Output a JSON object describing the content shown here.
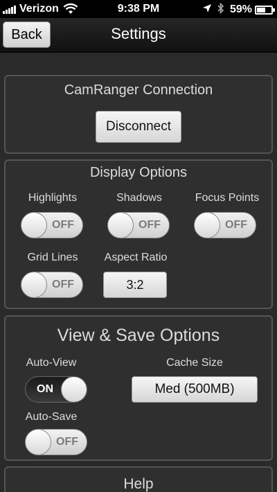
{
  "status_bar": {
    "carrier": "Verizon",
    "time": "9:38 PM",
    "battery": "59%",
    "battery_level_percent": 59,
    "icons": [
      "signal-icon",
      "wifi-icon",
      "location-icon",
      "bluetooth-icon",
      "battery-icon"
    ]
  },
  "nav": {
    "back_label": "Back",
    "title": "Settings"
  },
  "connection": {
    "title": "CamRanger Connection",
    "disconnect_label": "Disconnect"
  },
  "display": {
    "title": "Display Options",
    "highlights": {
      "label": "Highlights",
      "state": "OFF"
    },
    "shadows": {
      "label": "Shadows",
      "state": "OFF"
    },
    "focus_points": {
      "label": "Focus Points",
      "state": "OFF"
    },
    "grid_lines": {
      "label": "Grid Lines",
      "state": "OFF"
    },
    "aspect_ratio": {
      "label": "Aspect Ratio",
      "value": "3:2"
    }
  },
  "view_save": {
    "title": "View & Save Options",
    "auto_view": {
      "label": "Auto-View",
      "state": "ON"
    },
    "cache_size": {
      "label": "Cache Size",
      "value": "Med (500MB)"
    },
    "auto_save": {
      "label": "Auto-Save",
      "state": "OFF"
    }
  },
  "help": {
    "title": "Help"
  }
}
